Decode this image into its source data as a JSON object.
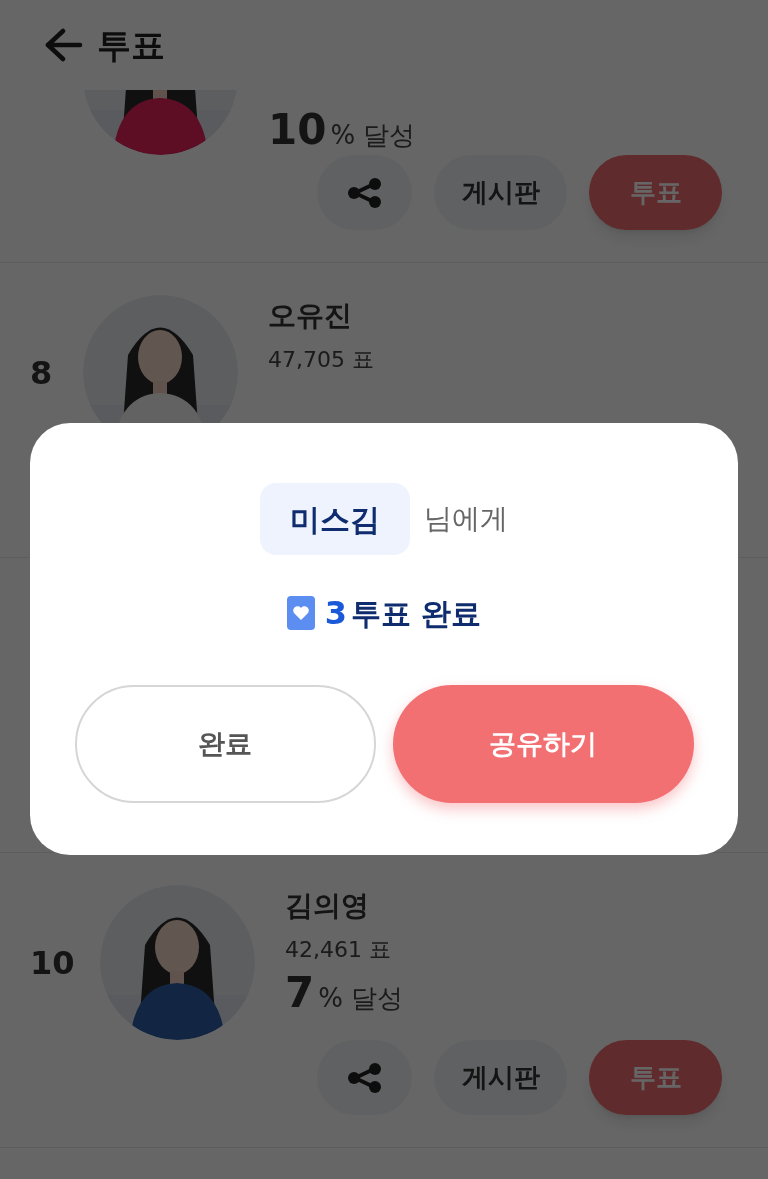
{
  "header": {
    "title": "투표"
  },
  "candidates": [
    {
      "percent": "10",
      "percent_suffix": "% 달성",
      "board_label": "게시판",
      "vote_label": "투표"
    },
    {
      "rank": "8",
      "name": "오유진",
      "votes": "47,705 표"
    }
  ],
  "candidates_below_dialog": [
    {
      "rank": "10",
      "name": "김의영",
      "votes": "42,461 표",
      "percent": "7",
      "percent_suffix": "% 달성",
      "board_label": "게시판",
      "vote_label": "투표"
    }
  ],
  "dialog": {
    "recipient": "미스김",
    "recipient_suffix": "님에게",
    "vote_count": "3",
    "vote_text": "투표 완료",
    "buttons": [
      {
        "label": "완료",
        "kind": "outline"
      },
      {
        "label": "공유하기",
        "kind": "primary"
      }
    ]
  }
}
